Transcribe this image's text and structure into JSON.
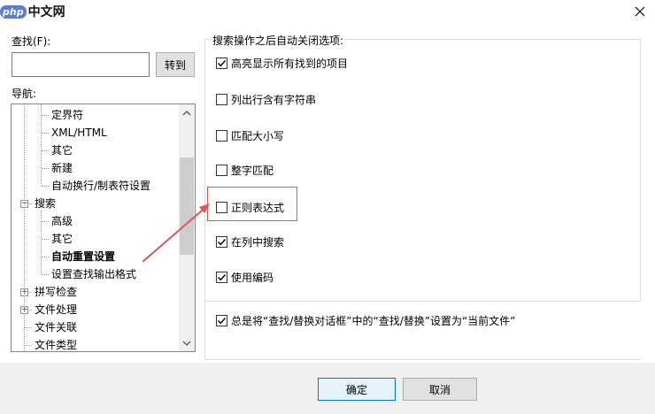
{
  "titlebar": {
    "logo_badge": "php",
    "logo_text": "中文网",
    "close_icon": "close-icon"
  },
  "find": {
    "label": "查找(F):",
    "value": "",
    "goto_label": "转到"
  },
  "nav": {
    "label": "导航:",
    "items": [
      {
        "label": "定界符",
        "level": 2,
        "bold": false
      },
      {
        "label": "XML/HTML",
        "level": 2,
        "bold": false
      },
      {
        "label": "其它",
        "level": 2,
        "bold": false
      },
      {
        "label": "新建",
        "level": 2,
        "bold": false
      },
      {
        "label": "自动换行/制表符设置",
        "level": 2,
        "bold": false
      },
      {
        "label": "搜索",
        "level": 1,
        "expander": "−",
        "bold": false
      },
      {
        "label": "高级",
        "level": 2,
        "bold": false
      },
      {
        "label": "其它",
        "level": 2,
        "bold": false
      },
      {
        "label": "自动重置设置",
        "level": 2,
        "bold": true
      },
      {
        "label": "设置查找输出格式",
        "level": 2,
        "bold": false
      },
      {
        "label": "拼写检查",
        "level": 1,
        "expander": "+",
        "bold": false
      },
      {
        "label": "文件处理",
        "level": 1,
        "expander": "+",
        "bold": false
      },
      {
        "label": "文件关联",
        "level": 1,
        "bold": false
      },
      {
        "label": "文件类型",
        "level": 1,
        "bold": false
      }
    ]
  },
  "options": {
    "group_title": "搜索操作之后自动关闭选项:",
    "items": [
      {
        "label": "高亮显示所有找到的项目",
        "checked": true
      },
      {
        "label": "列出行含有字符串",
        "checked": false
      },
      {
        "label": "匹配大小写",
        "checked": false
      },
      {
        "label": "整字匹配",
        "checked": false
      },
      {
        "label": "正则表达式",
        "checked": false
      },
      {
        "label": "在列中搜索",
        "checked": true
      },
      {
        "label": "使用编码",
        "checked": true
      }
    ],
    "bottom": {
      "label": "总是将“查找/替换对话框”中的“查找/替换”设置为“当前文件”",
      "checked": true
    }
  },
  "buttons": {
    "ok": "确定",
    "cancel": "取消"
  },
  "colors": {
    "annotation_red": "#e05555",
    "check_color": "#000000",
    "accent": "#0078d7"
  }
}
